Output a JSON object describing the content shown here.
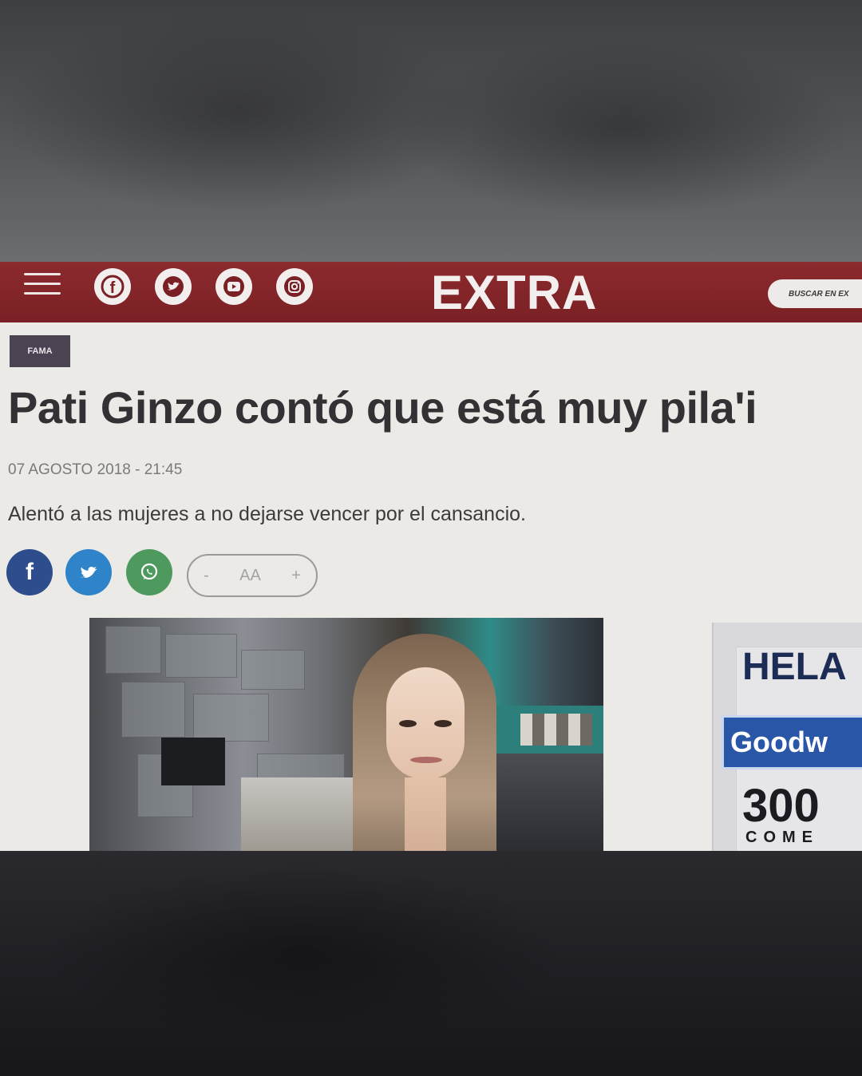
{
  "header": {
    "logo": "EXTRA",
    "search_label": "BUSCAR EN EX",
    "social_icons": [
      "facebook-icon",
      "twitter-icon",
      "youtube-icon",
      "instagram-icon"
    ],
    "menu_icon": "hamburger-menu-icon",
    "brand_color": "#8c2a2e"
  },
  "article": {
    "category": "FAMA",
    "headline": "Pati Ginzo contó que está muy pila'i",
    "date": "07 AGOSTO 2018 - 21:45",
    "summary": "Alentó a las mujeres a no dejarse vencer por el cansancio.",
    "share": {
      "facebook_glyph": "f",
      "whatsapp_icon": "whatsapp-icon",
      "font_minus": "-",
      "font_label": "AA",
      "font_plus": "+"
    },
    "image_icon": "news-photo"
  },
  "ad": {
    "line1": "HELA",
    "line2": "Goodw",
    "line3": "300",
    "line4": "COME"
  }
}
